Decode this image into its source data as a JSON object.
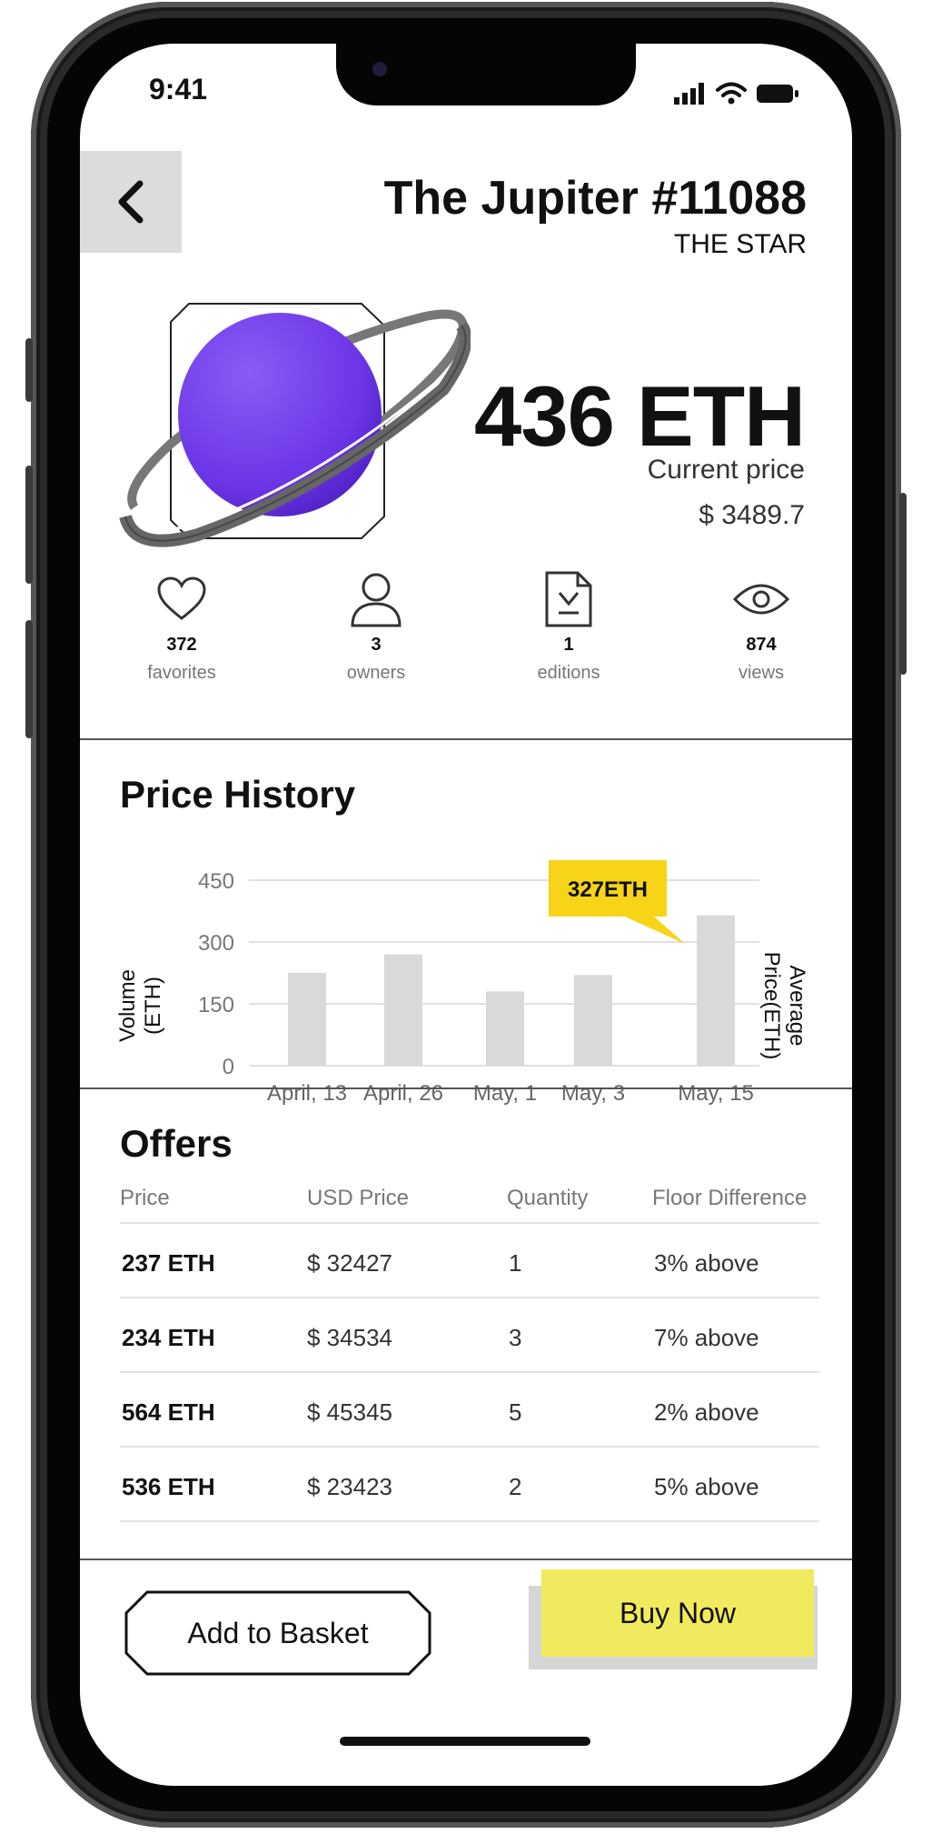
{
  "status_bar": {
    "time": "9:41"
  },
  "nft": {
    "title": "The Jupiter #11088",
    "collection": "THE STAR",
    "price": "436 ETH",
    "price_label": "Current price",
    "price_usd": "$ 3489.7",
    "art_color": "#6a35e6"
  },
  "stats": [
    {
      "icon": "heart-icon",
      "count": "372",
      "label": "favorites"
    },
    {
      "icon": "user-icon",
      "count": "3",
      "label": "owners"
    },
    {
      "icon": "document-download-icon",
      "count": "1",
      "label": "editions"
    },
    {
      "icon": "eye-icon",
      "count": "874",
      "label": "views"
    }
  ],
  "price_history": {
    "title": "Price History",
    "tooltip": "327ETH",
    "tooltip_color": "#f7d417"
  },
  "chart_data": {
    "type": "bar",
    "categories": [
      "April, 13",
      "April, 26",
      "May, 1",
      "May, 3",
      "May, 15"
    ],
    "values": [
      225,
      270,
      180,
      220,
      365
    ],
    "ylim": [
      0,
      450
    ],
    "yticks": [
      "0",
      "150",
      "300",
      "450"
    ],
    "ylabel": "Volume (ETH)",
    "y2label": "Average Price(ETH)",
    "grid": true,
    "bar_color": "#d9d9d9"
  },
  "offers": {
    "title": "Offers",
    "columns": [
      "Price",
      "USD Price",
      "Quantity",
      "Floor Difference"
    ],
    "rows": [
      [
        "237 ETH",
        "$ 32427",
        "1",
        "3% above"
      ],
      [
        "234 ETH",
        "$ 34534",
        "3",
        "7% above"
      ],
      [
        "564 ETH",
        "$ 45345",
        "5",
        "2% above"
      ],
      [
        "536 ETH",
        "$ 23423",
        "2",
        "5% above"
      ]
    ]
  },
  "actions": {
    "basket_label": "Add to Basket",
    "buy_label": "Buy Now",
    "buy_color": "#f2ea5e"
  }
}
